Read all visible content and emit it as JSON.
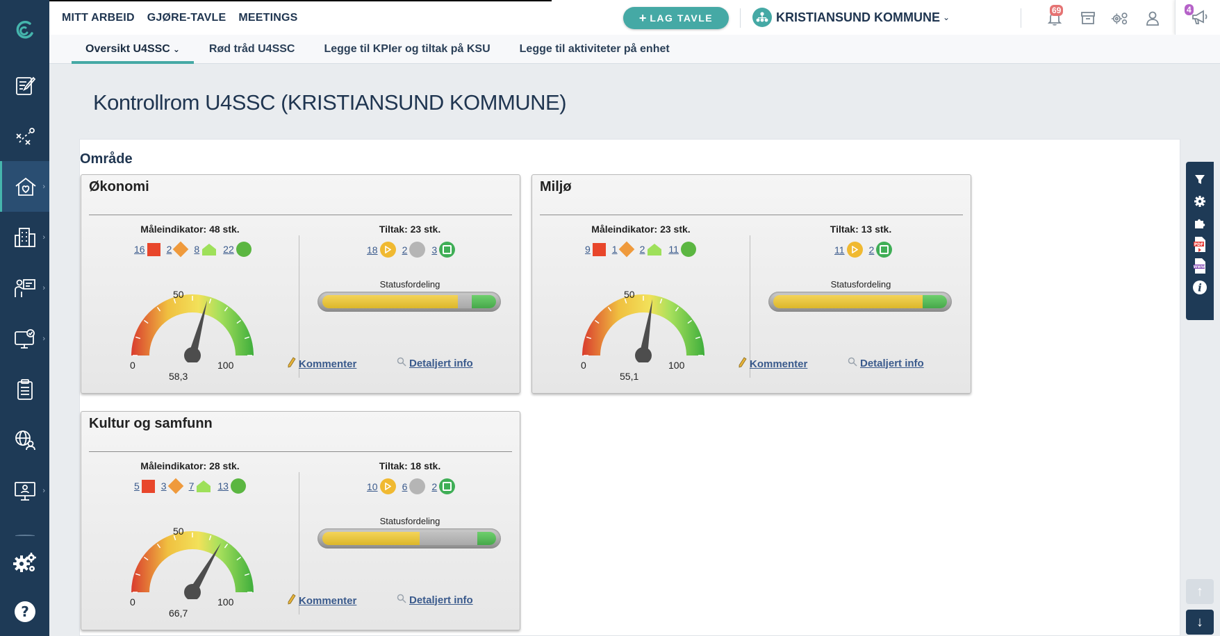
{
  "nav": {
    "links": [
      "MITT ARBEID",
      "GJØRE-TAVLE",
      "MEETINGS"
    ],
    "lag_tavle": "LAG TAVLE",
    "org_name": "KRISTIANSUND KOMMUNE",
    "notifications_count": "69",
    "announcements_count": "4"
  },
  "subnav": {
    "tabs": [
      "Oversikt U4SSC",
      "Rød tråd U4SSC",
      "Legge til KPIer og tiltak på KSU",
      "Legge til aktiviteter på enhet"
    ]
  },
  "page": {
    "title": "Kontrollrom U4SSC (KRISTIANSUND KOMMUNE)",
    "area_heading": "Område"
  },
  "cards": [
    {
      "title": "Økonomi",
      "indicator_head": "Måleindikator: 48 stk.",
      "indicator_counts": [
        "16",
        "2",
        "8",
        "22"
      ],
      "tiltak_head": "Tiltak: 23 stk.",
      "tiltak_counts": [
        "18",
        "2",
        "3"
      ],
      "status_label": "Statusfordeling",
      "status_fill": {
        "yellow": 0.78,
        "grey": 0.08,
        "green": 0.14
      },
      "gauge_value": 58.3,
      "gauge_text": "58,3",
      "gauge_min": "0",
      "gauge_mid": "50",
      "gauge_max": "100",
      "kommenter": "Kommenter",
      "detaljert": "Detaljert info"
    },
    {
      "title": "Miljø",
      "indicator_head": "Måleindikator: 23 stk.",
      "indicator_counts": [
        "9",
        "1",
        "2",
        "11"
      ],
      "tiltak_head": "Tiltak: 13 stk.",
      "tiltak_counts": [
        "11",
        "2"
      ],
      "status_label": "Statusfordeling",
      "status_fill": {
        "yellow": 0.86,
        "grey": 0.0,
        "green": 0.14
      },
      "gauge_value": 55.1,
      "gauge_text": "55,1",
      "gauge_min": "0",
      "gauge_mid": "50",
      "gauge_max": "100",
      "kommenter": "Kommenter",
      "detaljert": "Detaljert info"
    },
    {
      "title": "Kultur og samfunn",
      "indicator_head": "Måleindikator: 28 stk.",
      "indicator_counts": [
        "5",
        "3",
        "7",
        "13"
      ],
      "tiltak_head": "Tiltak: 18 stk.",
      "tiltak_counts": [
        "10",
        "6",
        "2"
      ],
      "status_label": "Statusfordeling",
      "status_fill": {
        "yellow": 0.56,
        "grey": 0.33,
        "green": 0.11
      },
      "gauge_value": 66.7,
      "gauge_text": "66,7",
      "gauge_min": "0",
      "gauge_mid": "50",
      "gauge_max": "100",
      "kommenter": "Kommenter",
      "detaljert": "Detaljert info"
    }
  ],
  "icons": {
    "sidebar": [
      "logo-icon",
      "form-edit-icon",
      "strategy-icon",
      "home-heart-icon",
      "buildings-icon",
      "presentation-icon",
      "monitor-check-icon",
      "clipboard-list-icon",
      "globe-person-icon",
      "teacher-screen-icon",
      "settings-gears-icon",
      "help-icon"
    ],
    "right_tools": [
      "filter-icon",
      "gear-icon",
      "puzzle-icon",
      "pdf-icon",
      "www-icon",
      "info-icon"
    ]
  },
  "colors": {
    "sidebar": "#1e3a56",
    "accent": "#45a9a5",
    "red": "#e8462b",
    "orange": "#ef9a3c",
    "lightgreen": "#9ee05a",
    "green": "#5bb641",
    "yellow": "#f0b931"
  }
}
